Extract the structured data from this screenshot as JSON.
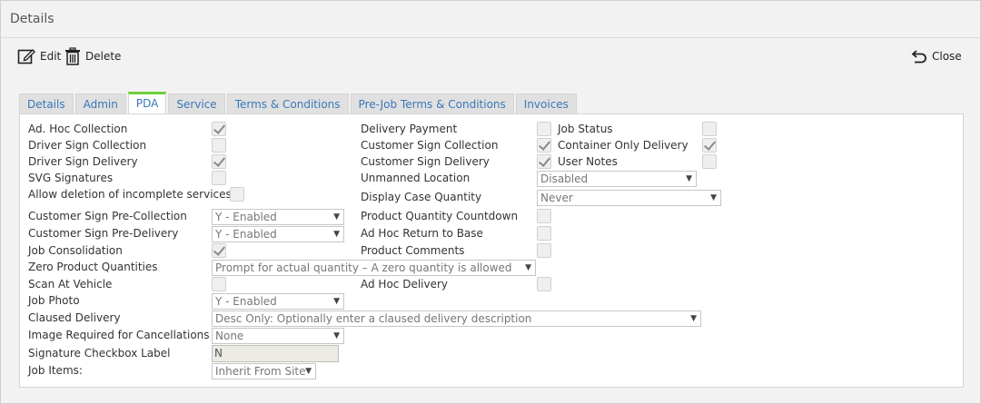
{
  "window": {
    "title": "Details"
  },
  "toolbar": {
    "edit_label": "Edit",
    "delete_label": "Delete",
    "close_label": "Close"
  },
  "tabs": [
    "Details",
    "Admin",
    "PDA",
    "Service",
    "Terms & Conditions",
    "Pre-Job Terms & Conditions",
    "Invoices"
  ],
  "active_tab": "PDA",
  "col1": {
    "ad_hoc_collection": {
      "label": "Ad. Hoc Collection",
      "checked": true
    },
    "driver_sign_collection": {
      "label": "Driver Sign Collection",
      "checked": false
    },
    "driver_sign_delivery": {
      "label": "Driver Sign Delivery",
      "checked": true
    },
    "svg_signatures": {
      "label": "SVG Signatures",
      "checked": false
    },
    "allow_deletion": {
      "label": "Allow deletion of incomplete services",
      "checked": false
    },
    "customer_sign_pre_collection": {
      "label": "Customer Sign Pre-Collection",
      "value": "Y - Enabled"
    },
    "customer_sign_pre_delivery": {
      "label": "Customer Sign Pre-Delivery",
      "value": "Y - Enabled"
    },
    "job_consolidation": {
      "label": "Job Consolidation",
      "checked": true
    },
    "zero_product_quantities": {
      "label": "Zero Product Quantities",
      "value": "Prompt for actual quantity – A zero quantity is allowed"
    },
    "scan_at_vehicle": {
      "label": "Scan At Vehicle",
      "checked": false
    },
    "job_photo": {
      "label": "Job Photo",
      "value": "Y - Enabled"
    },
    "claused_delivery": {
      "label": "Claused Delivery",
      "value": "Desc Only: Optionally enter a claused delivery description"
    },
    "image_required": {
      "label": "Image Required for Cancellations",
      "value": "None"
    },
    "signature_checkbox_label": {
      "label": "Signature Checkbox Label",
      "value": "N"
    },
    "job_items": {
      "label": "Job Items:",
      "value": "Inherit From Site"
    }
  },
  "col2": {
    "delivery_payment": {
      "label": "Delivery Payment",
      "checked": false
    },
    "customer_sign_collection": {
      "label": "Customer Sign Collection",
      "checked": true
    },
    "customer_sign_delivery": {
      "label": "Customer Sign Delivery",
      "checked": true
    },
    "unmanned_location": {
      "label": "Unmanned Location",
      "value": "Disabled"
    },
    "display_case_quantity": {
      "label": "Display Case Quantity",
      "value": "Never"
    },
    "product_quantity_countdown": {
      "label": "Product Quantity Countdown",
      "checked": false
    },
    "ad_hoc_return_to_base": {
      "label": "Ad Hoc Return to Base",
      "checked": false
    },
    "product_comments": {
      "label": "Product Comments",
      "checked": false
    },
    "ad_hoc_delivery": {
      "label": "Ad Hoc Delivery",
      "checked": false
    }
  },
  "col3": {
    "job_status": {
      "label": "Job Status",
      "checked": false
    },
    "container_only_delivery": {
      "label": "Container Only Delivery",
      "checked": true
    },
    "user_notes": {
      "label": "User Notes",
      "checked": false
    }
  },
  "icons": {
    "edit": "edit-icon",
    "delete": "trash-icon",
    "close": "return-arrow-icon",
    "dropdown": "chevron-down-icon"
  }
}
